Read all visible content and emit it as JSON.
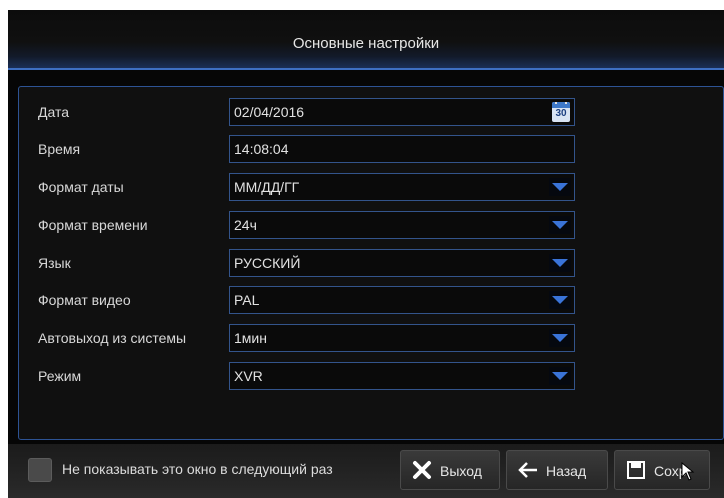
{
  "window": {
    "title": "Основные настройки"
  },
  "settings": [
    {
      "label": "Дата",
      "value": "02/04/2016",
      "control": "date",
      "icon": "calendar-icon",
      "icon_text": "30"
    },
    {
      "label": "Время",
      "value": "14:08:04",
      "control": "text"
    },
    {
      "label": "Формат даты",
      "value": "ММ/ДД/ГГ",
      "control": "dropdown"
    },
    {
      "label": "Формат времени",
      "value": "24ч",
      "control": "dropdown"
    },
    {
      "label": "Язык",
      "value": "РУССКИЙ",
      "control": "dropdown"
    },
    {
      "label": "Формат видео",
      "value": "PAL",
      "control": "dropdown"
    },
    {
      "label": "Автовыход из системы",
      "value": "1мин",
      "control": "dropdown"
    },
    {
      "label": "Режим",
      "value": "XVR",
      "control": "dropdown"
    }
  ],
  "footer": {
    "dont_show_label": "Не показывать это окно в следующий раз",
    "dont_show_checked": false,
    "exit_label": "Выход",
    "back_label": "Назад",
    "save_label": "Сохр."
  },
  "colors": {
    "accent": "#3a74d9",
    "border": "#33548b",
    "background": "#060606"
  }
}
